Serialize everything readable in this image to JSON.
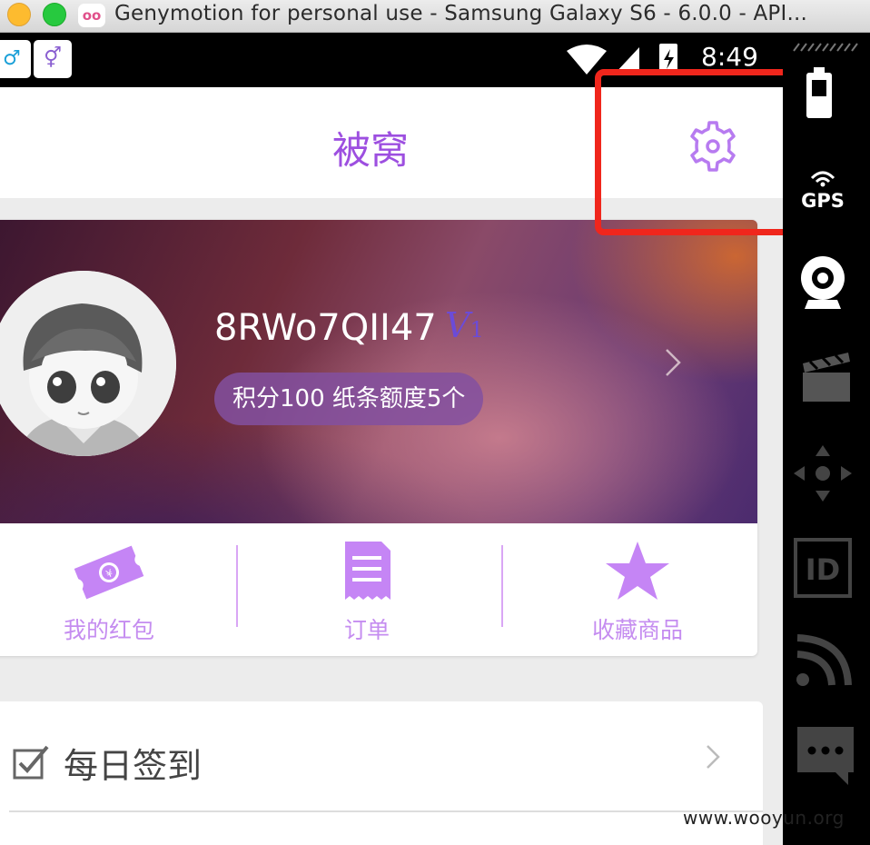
{
  "window": {
    "title": "Genymotion for personal use - Samsung Galaxy S6 - 6.0.0 - API...",
    "app_logo": "oo"
  },
  "statusbar": {
    "notif_1_glyph": "♂",
    "notif_2_glyph": "⚥",
    "time": "8:49"
  },
  "app": {
    "title": "被窝",
    "username": "8RWo7QII47",
    "vip_letter": "V",
    "vip_level": "1",
    "points_text": "积分100  纸条额度5个",
    "quick_links": [
      {
        "label": "我的红包",
        "icon": "red-packet-icon"
      },
      {
        "label": "订单",
        "icon": "order-receipt-icon"
      },
      {
        "label": "收藏商品",
        "icon": "star-icon"
      }
    ],
    "checkin_label": "每日签到"
  },
  "toolbar": {
    "items": [
      "battery-icon",
      "gps-icon",
      "webcam-icon",
      "capture-icon",
      "remote-control-icon",
      "device-id-icon",
      "network-icon",
      "sms-icon"
    ],
    "gps_label": "GPS",
    "id_label": "ID"
  },
  "colors": {
    "accent": "#9d4fe0",
    "accent_light": "#c58df0",
    "highlight": "#f0261c"
  },
  "watermark": "www.wooyun.org"
}
